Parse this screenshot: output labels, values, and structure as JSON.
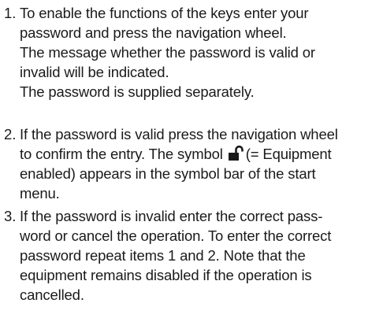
{
  "items": [
    {
      "number": "1.",
      "lines": [
        "To enable the functions of the keys enter your",
        "password and press the navigation wheel.",
        "The message whether the password is valid or",
        "invalid will be indicated.",
        "The password is supplied separately."
      ]
    },
    {
      "number": "2.",
      "line1": "If the password is valid press the navigation wheel",
      "line2_before": "to confirm the entry. The symbol",
      "line2_after": "(= Equipment",
      "line3": "enabled) appears in the symbol bar of the start",
      "line4": "menu.",
      "icon": "unlocked-padlock-icon"
    },
    {
      "number": "3.",
      "lines": [
        "If the password is invalid enter the correct pass-",
        "word or cancel the operation. To enter the correct",
        "password repeat items 1 and 2. Note that the",
        "equipment remains disabled if the operation is",
        "cancelled."
      ]
    }
  ]
}
